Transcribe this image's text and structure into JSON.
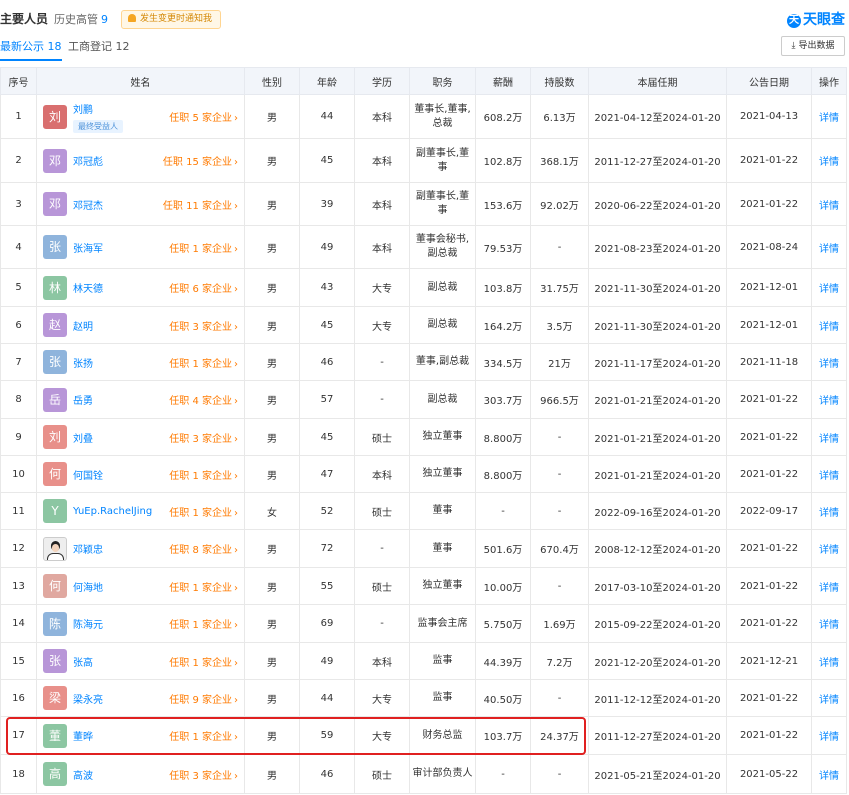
{
  "header": {
    "title": "主要人员",
    "history_label": "历史高管",
    "history_count": "9",
    "notice": "发生变更时通知我",
    "brand_logo": "天",
    "brand": "天眼查"
  },
  "tabs": {
    "active": "最新公示 18",
    "inactive": "工商登记 12",
    "export": "导出数据"
  },
  "columns": [
    "序号",
    "姓名",
    "性别",
    "年龄",
    "学历",
    "职务",
    "薪酬",
    "持股数",
    "本届任期",
    "公告日期",
    "操作"
  ],
  "rows": [
    {
      "no": "1",
      "avatar": "刘",
      "color": "#d96f6f",
      "name": "刘鹏",
      "badge": "最终受益人",
      "corp": "任职 5 家企业",
      "gender": "男",
      "age": "44",
      "edu": "本科",
      "pos": "董事长,董事,总裁",
      "pay": "608.2万",
      "shares": "6.13万",
      "term": "2021-04-12至2024-01-20",
      "date": "2021-04-13",
      "op": "详情"
    },
    {
      "no": "2",
      "avatar": "邓",
      "color": "#b896d8",
      "name": "邓冠彪",
      "corp": "任职 15 家企业",
      "gender": "男",
      "age": "45",
      "edu": "本科",
      "pos": "副董事长,董事",
      "pay": "102.8万",
      "shares": "368.1万",
      "term": "2011-12-27至2024-01-20",
      "date": "2021-01-22",
      "op": "详情"
    },
    {
      "no": "3",
      "avatar": "邓",
      "color": "#b896d8",
      "name": "邓冠杰",
      "corp": "任职 11 家企业",
      "gender": "男",
      "age": "39",
      "edu": "本科",
      "pos": "副董事长,董事",
      "pay": "153.6万",
      "shares": "92.02万",
      "term": "2020-06-22至2024-01-20",
      "date": "2021-01-22",
      "op": "详情"
    },
    {
      "no": "4",
      "avatar": "张",
      "color": "#8fb4dc",
      "name": "张海军",
      "corp": "任职 1 家企业",
      "gender": "男",
      "age": "49",
      "edu": "本科",
      "pos": "董事会秘书,副总裁",
      "pay": "79.53万",
      "shares": "-",
      "term": "2021-08-23至2024-01-20",
      "date": "2021-08-24",
      "op": "详情"
    },
    {
      "no": "5",
      "avatar": "林",
      "color": "#8cc6a2",
      "name": "林天德",
      "corp": "任职 6 家企业",
      "gender": "男",
      "age": "43",
      "edu": "大专",
      "pos": "副总裁",
      "pay": "103.8万",
      "shares": "31.75万",
      "term": "2021-11-30至2024-01-20",
      "date": "2021-12-01",
      "op": "详情"
    },
    {
      "no": "6",
      "avatar": "赵",
      "color": "#b896d8",
      "name": "赵明",
      "corp": "任职 3 家企业",
      "gender": "男",
      "age": "45",
      "edu": "大专",
      "pos": "副总裁",
      "pay": "164.2万",
      "shares": "3.5万",
      "term": "2021-11-30至2024-01-20",
      "date": "2021-12-01",
      "op": "详情"
    },
    {
      "no": "7",
      "avatar": "张",
      "color": "#8fb4dc",
      "name": "张扬",
      "corp": "任职 1 家企业",
      "gender": "男",
      "age": "46",
      "edu": "-",
      "pos": "董事,副总裁",
      "pay": "334.5万",
      "shares": "21万",
      "term": "2021-11-17至2024-01-20",
      "date": "2021-11-18",
      "op": "详情"
    },
    {
      "no": "8",
      "avatar": "岳",
      "color": "#b896d8",
      "name": "岳勇",
      "corp": "任职 4 家企业",
      "gender": "男",
      "age": "57",
      "edu": "-",
      "pos": "副总裁",
      "pay": "303.7万",
      "shares": "966.5万",
      "term": "2021-01-21至2024-01-20",
      "date": "2021-01-22",
      "op": "详情"
    },
    {
      "no": "9",
      "avatar": "刘",
      "color": "#e8908a",
      "name": "刘叠",
      "corp": "任职 3 家企业",
      "gender": "男",
      "age": "45",
      "edu": "硕士",
      "pos": "独立董事",
      "pay": "8.800万",
      "shares": "-",
      "term": "2021-01-21至2024-01-20",
      "date": "2021-01-22",
      "op": "详情"
    },
    {
      "no": "10",
      "avatar": "何",
      "color": "#e8908a",
      "name": "何国铨",
      "corp": "任职 1 家企业",
      "gender": "男",
      "age": "47",
      "edu": "本科",
      "pos": "独立董事",
      "pay": "8.800万",
      "shares": "-",
      "term": "2021-01-21至2024-01-20",
      "date": "2021-01-22",
      "op": "详情"
    },
    {
      "no": "11",
      "avatar": "Y",
      "color": "#8cc6a2",
      "name": "YuEp.RachelJing",
      "corp": "任职 1 家企业",
      "gender": "女",
      "age": "52",
      "edu": "硕士",
      "pos": "董事",
      "pay": "-",
      "shares": "-",
      "term": "2022-09-16至2024-01-20",
      "date": "2022-09-17",
      "op": "详情"
    },
    {
      "no": "12",
      "avatar": "",
      "photo": true,
      "color": "#eeeeee",
      "name": "邓颖忠",
      "corp": "任职 8 家企业",
      "gender": "男",
      "age": "72",
      "edu": "-",
      "pos": "董事",
      "pay": "501.6万",
      "shares": "670.4万",
      "term": "2008-12-12至2024-01-20",
      "date": "2021-01-22",
      "op": "详情"
    },
    {
      "no": "13",
      "avatar": "何",
      "color": "#e0a8a0",
      "name": "何海地",
      "corp": "任职 1 家企业",
      "gender": "男",
      "age": "55",
      "edu": "硕士",
      "pos": "独立董事",
      "pay": "10.00万",
      "shares": "-",
      "term": "2017-03-10至2024-01-20",
      "date": "2021-01-22",
      "op": "详情"
    },
    {
      "no": "14",
      "avatar": "陈",
      "color": "#8fb4dc",
      "name": "陈海元",
      "corp": "任职 1 家企业",
      "gender": "男",
      "age": "69",
      "edu": "-",
      "pos": "监事会主席",
      "pay": "5.750万",
      "shares": "1.69万",
      "term": "2015-09-22至2024-01-20",
      "date": "2021-01-22",
      "op": "详情"
    },
    {
      "no": "15",
      "avatar": "张",
      "color": "#b896d8",
      "name": "张高",
      "corp": "任职 1 家企业",
      "gender": "男",
      "age": "49",
      "edu": "本科",
      "pos": "监事",
      "pay": "44.39万",
      "shares": "7.2万",
      "term": "2021-12-20至2024-01-20",
      "date": "2021-12-21",
      "op": "详情"
    },
    {
      "no": "16",
      "avatar": "梁",
      "color": "#e8908a",
      "name": "梁永亮",
      "corp": "任职 9 家企业",
      "gender": "男",
      "age": "44",
      "edu": "大专",
      "pos": "监事",
      "pay": "40.50万",
      "shares": "-",
      "term": "2011-12-12至2024-01-20",
      "date": "2021-01-22",
      "op": "详情"
    },
    {
      "no": "17",
      "avatar": "董",
      "color": "#8cc6a2",
      "name": "董晔",
      "corp": "任职 1 家企业",
      "gender": "男",
      "age": "59",
      "edu": "大专",
      "pos": "财务总监",
      "pay": "103.7万",
      "shares": "24.37万",
      "term": "2011-12-27至2024-01-20",
      "date": "2021-01-22",
      "op": "详情"
    },
    {
      "no": "18",
      "avatar": "高",
      "color": "#8cc6a2",
      "name": "高波",
      "corp": "任职 3 家企业",
      "gender": "男",
      "age": "46",
      "edu": "硕士",
      "pos": "审计部负责人",
      "pay": "-",
      "shares": "-",
      "term": "2021-05-21至2024-01-20",
      "date": "2021-05-22",
      "op": "详情"
    }
  ]
}
